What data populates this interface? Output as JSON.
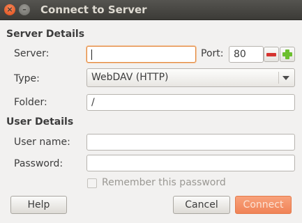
{
  "window": {
    "title": "Connect to Server"
  },
  "server_details": {
    "heading": "Server Details",
    "server_label": "Server:",
    "server_value": "",
    "port_label": "Port:",
    "port_value": "80",
    "type_label": "Type:",
    "type_value": "WebDAV (HTTP)",
    "folder_label": "Folder:",
    "folder_value": "/"
  },
  "user_details": {
    "heading": "User Details",
    "username_label": "User name:",
    "username_value": "",
    "password_label": "Password:",
    "password_value": "",
    "remember_label": "Remember this password",
    "remember_checked": false
  },
  "buttons": {
    "help": "Help",
    "cancel": "Cancel",
    "connect": "Connect"
  },
  "icons": {
    "close": "close-icon",
    "minimize": "minimize-icon",
    "port_decrement": "minus-icon",
    "port_increment": "plus-icon",
    "type_dropdown": "chevron-down-icon"
  },
  "colors": {
    "titlebar": "#3c3b37",
    "focus_border": "#e2873b",
    "connect_button": "#f08357",
    "minus": "#d5332f",
    "plus": "#6cbf2e"
  }
}
